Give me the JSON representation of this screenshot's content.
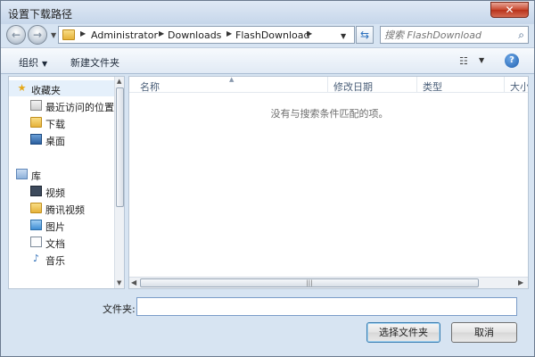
{
  "window": {
    "title": "设置下载路径"
  },
  "address": {
    "breadcrumbs": [
      "Administrator",
      "Downloads",
      "FlashDownload"
    ]
  },
  "search": {
    "placeholder": "搜索 FlashDownload"
  },
  "toolbar": {
    "organize_label": "组织",
    "new_folder_label": "新建文件夹"
  },
  "sidebar": {
    "items": [
      {
        "label": "收藏夹",
        "icon": "star-icon"
      },
      {
        "label": "最近访问的位置",
        "icon": "recent-places-icon"
      },
      {
        "label": "下载",
        "icon": "folder-icon"
      },
      {
        "label": "桌面",
        "icon": "desktop-icon"
      },
      {
        "label": "库",
        "icon": "library-icon"
      },
      {
        "label": "视频",
        "icon": "video-icon"
      },
      {
        "label": "腾讯视频",
        "icon": "folder-icon"
      },
      {
        "label": "图片",
        "icon": "picture-icon"
      },
      {
        "label": "文档",
        "icon": "document-icon"
      },
      {
        "label": "音乐",
        "icon": "music-icon"
      }
    ]
  },
  "content": {
    "columns": [
      "名称",
      "修改日期",
      "类型",
      "大小"
    ],
    "empty_message": "没有与搜索条件匹配的项。"
  },
  "footer": {
    "filename_label": "文件夹:",
    "filename_value": "",
    "select_button": "选择文件夹",
    "cancel_button": "取消"
  }
}
